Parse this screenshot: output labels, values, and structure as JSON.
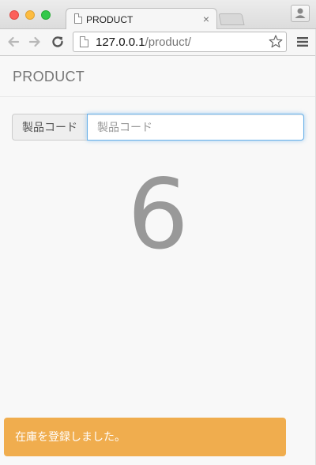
{
  "browser": {
    "tab": {
      "title": "PRODUCT",
      "close_glyph": "×"
    },
    "address": {
      "host": "127.0.0.1",
      "path": "/product/"
    },
    "icons": {
      "window_close": "close-window-icon",
      "window_minimize": "minimize-window-icon",
      "window_maximize": "maximize-window-icon",
      "tab_page": "document-icon",
      "new_tab": "new-tab-icon",
      "profile": "user-profile-icon",
      "back": "back-arrow-icon",
      "forward": "forward-arrow-icon",
      "reload": "reload-icon",
      "bookmark": "star-icon",
      "menu": "hamburger-menu-icon"
    }
  },
  "page": {
    "navbar": {
      "brand": "PRODUCT"
    },
    "form": {
      "product_code_label": "製品コード",
      "product_code_placeholder": "製品コード",
      "product_code_value": ""
    },
    "count": "6",
    "alert": "在庫を登録しました。"
  },
  "colors": {
    "alert_background": "#f0ad4e",
    "alert_text": "#ffffff",
    "count_text": "#999999",
    "input_focus_border": "#66afe9",
    "traffic_close": "#fc605b",
    "traffic_minimize": "#fdbc40",
    "traffic_maximize": "#34c84a"
  }
}
